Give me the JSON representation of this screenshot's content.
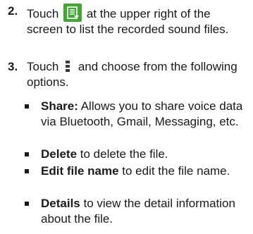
{
  "steps": [
    {
      "number": "2.",
      "text_before_icon": "Touch",
      "icon": "recordings-list-icon",
      "text_after_icon": "at the upper right of the screen to list the recorded sound files."
    },
    {
      "number": "3.",
      "text_before_icon": "Touch",
      "icon": "menu-dots-icon",
      "text_after_icon": "and choose from the following options."
    }
  ],
  "options": [
    {
      "term": "Share:",
      "description": "Allows you to share voice data via Bluetooth, Gmail, Messaging, etc."
    },
    {
      "term": "Delete",
      "description": "to delete the file."
    },
    {
      "term": "Edit file name",
      "description": "to edit the file name."
    },
    {
      "term": "Details",
      "description": "to view the detail information about the file."
    }
  ],
  "colors": {
    "list_icon_green": "#42a534",
    "text": "#1a1a1a"
  }
}
